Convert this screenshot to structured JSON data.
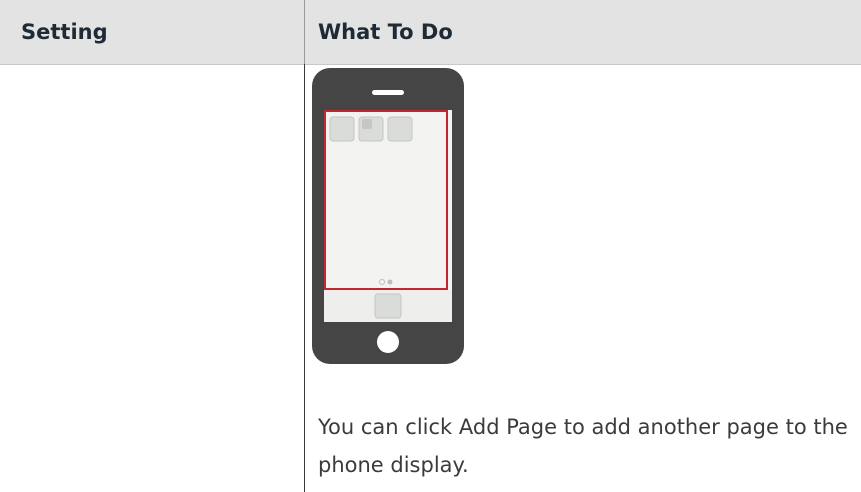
{
  "table": {
    "headers": {
      "setting": "Setting",
      "what_to_do": "What To Do"
    },
    "row": {
      "setting": "",
      "caption": "You can click Add Page to add another page to the phone display."
    }
  },
  "phone_illustration": {
    "body_color": "#444444",
    "highlight_color": "#c0282d",
    "app_tile_color": "#d9dbd9"
  }
}
